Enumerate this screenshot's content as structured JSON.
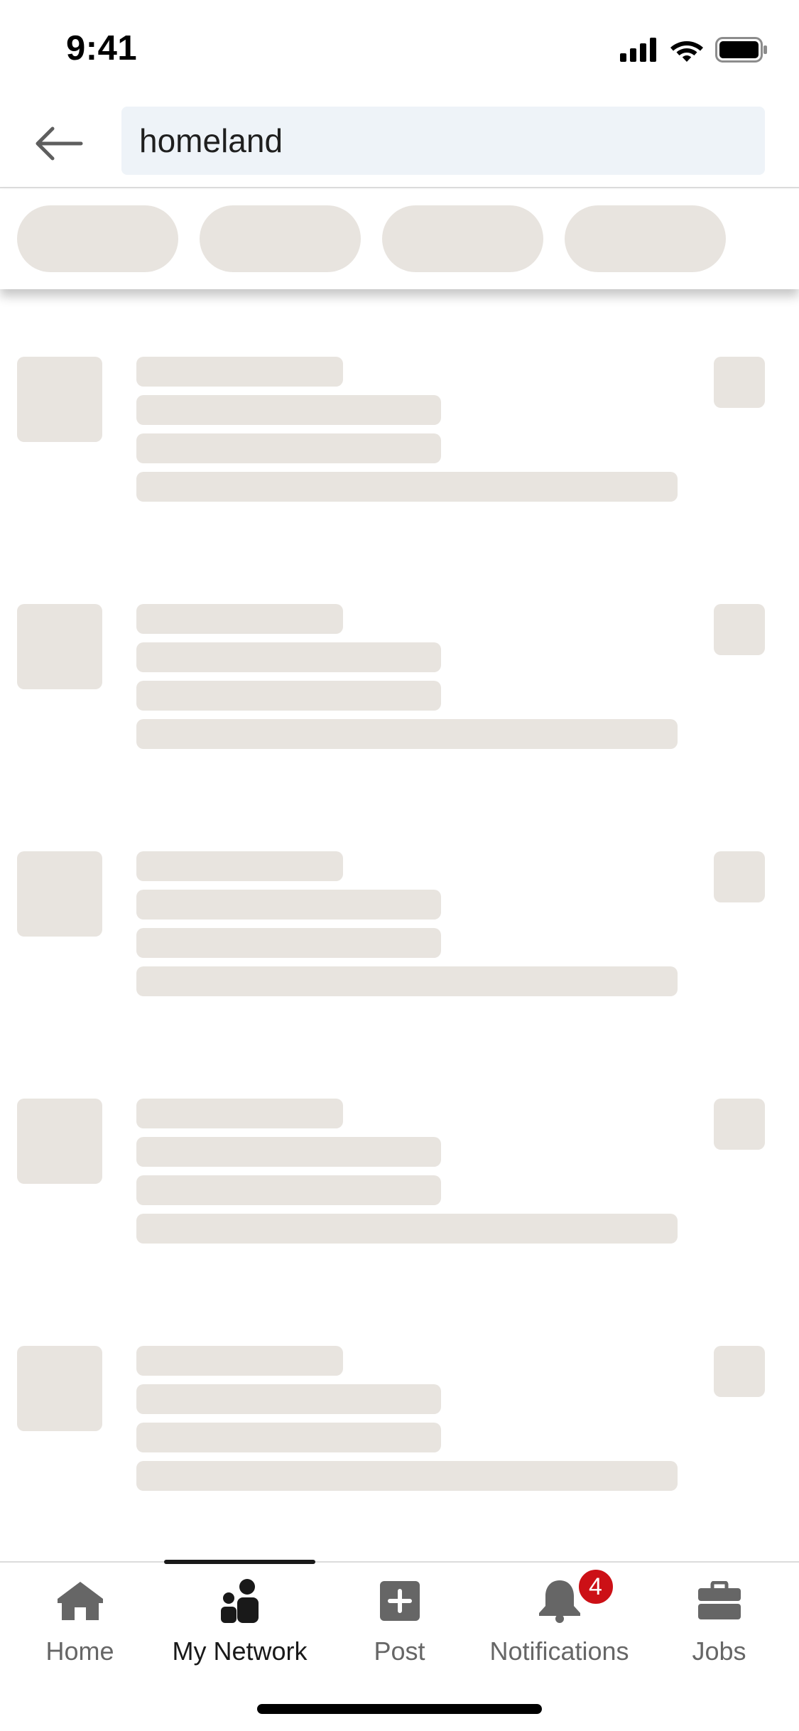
{
  "status_bar": {
    "time": "9:41"
  },
  "search": {
    "query": "homeland"
  },
  "filter_pills": {
    "count": 4,
    "state": "loading"
  },
  "results": {
    "state": "loading",
    "skeleton_rows": 5
  },
  "bottom_nav": {
    "active": "my-network",
    "items": [
      {
        "id": "home",
        "label": "Home",
        "icon": "home-icon"
      },
      {
        "id": "my-network",
        "label": "My Network",
        "icon": "people-icon"
      },
      {
        "id": "post",
        "label": "Post",
        "icon": "plus-square-icon"
      },
      {
        "id": "notifications",
        "label": "Notifications",
        "icon": "bell-icon",
        "badge": "4"
      },
      {
        "id": "jobs",
        "label": "Jobs",
        "icon": "briefcase-icon"
      }
    ]
  },
  "colors": {
    "skeleton": "#e8e4df",
    "search_bg": "#eef3f8",
    "badge": "#cc1016",
    "nav_inactive": "#666666",
    "nav_active": "#191919"
  }
}
